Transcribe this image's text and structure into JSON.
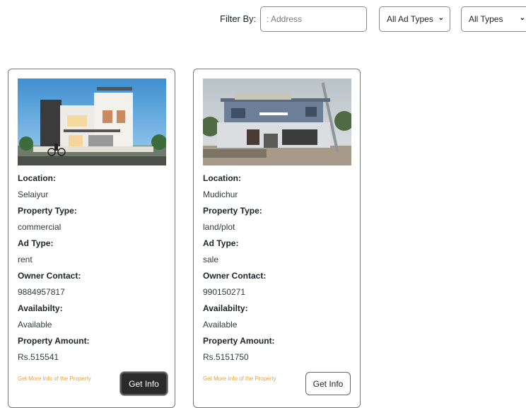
{
  "filter": {
    "label": "Filter By:",
    "address_placeholder": ": Address",
    "ad_type_selected": "All Ad Types",
    "type_selected": "All Types"
  },
  "listings": [
    {
      "location_label": "Location:",
      "location": "Selaiyur",
      "property_type_label": "Property Type:",
      "property_type": "commercial",
      "ad_type_label": "Ad Type:",
      "ad_type": "rent",
      "owner_contact_label": "Owner Contact:",
      "owner_contact": "9884957817",
      "availability_label": "Availabilty:",
      "availability": "Available",
      "amount_label": "Property Amount:",
      "amount": "Rs.515541",
      "more_info": "Get More Info of the Property",
      "button": "Get Info"
    },
    {
      "location_label": "Location:",
      "location": "Mudichur",
      "property_type_label": "Property Type:",
      "property_type": "land/plot",
      "ad_type_label": "Ad Type:",
      "ad_type": "sale",
      "owner_contact_label": "Owner Contact:",
      "owner_contact": "990150271",
      "availability_label": "Availabilty:",
      "availability": "Available",
      "amount_label": "Property Amount:",
      "amount": "Rs.5151750",
      "more_info": "Get More Info of the Property",
      "button": "Get Info"
    }
  ],
  "colors": {
    "link_orange": "#f0a030",
    "button_dark": "#2b2b2b"
  }
}
